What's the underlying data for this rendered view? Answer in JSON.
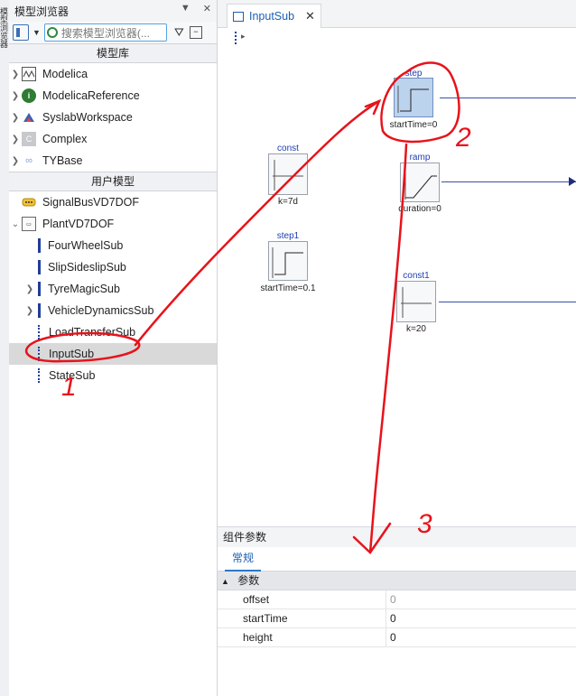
{
  "left_panel": {
    "title": "模型浏览器",
    "header_buttons": [
      "▼",
      "✕"
    ],
    "search_placeholder": "搜索模型浏览器(...",
    "section_library": "模型库",
    "section_user": "用户模型",
    "library_items": [
      {
        "label": "Modelica",
        "icon": "modelica-icon"
      },
      {
        "label": "ModelicaReference",
        "icon": "info-icon"
      },
      {
        "label": "SyslabWorkspace",
        "icon": "syslab-icon"
      },
      {
        "label": "Complex",
        "icon": "complex-icon"
      },
      {
        "label": "TYBase",
        "icon": "tybase-icon"
      }
    ],
    "user_items": [
      {
        "label": "SignalBusVD7DOF"
      },
      {
        "label": "PlantVD7DOF"
      }
    ],
    "plant_children": [
      {
        "label": "FourWheelSub"
      },
      {
        "label": "SlipSideslipSub"
      },
      {
        "label": "TyreMagicSub"
      },
      {
        "label": "VehicleDynamicsSub"
      },
      {
        "label": "LoadTransferSub"
      },
      {
        "label": "InputSub"
      },
      {
        "label": "StateSub"
      }
    ]
  },
  "vertical_strip_text": "模型浏览器",
  "editor": {
    "tab_label": "InputSub",
    "tab_close": "✕",
    "blocks": [
      {
        "name": "step",
        "param": "startTime=0"
      },
      {
        "name": "const",
        "param": "k=7d"
      },
      {
        "name": "ramp",
        "param": "duration=0"
      },
      {
        "name": "step1",
        "param": "startTime=0.1"
      },
      {
        "name": "const1",
        "param": "k=20"
      }
    ]
  },
  "params_panel": {
    "title": "组件参数",
    "tab": "常规",
    "group": "参数",
    "rows": [
      {
        "name": "offset",
        "value": "0"
      },
      {
        "name": "startTime",
        "value": "0"
      },
      {
        "name": "height",
        "value": "0"
      }
    ]
  },
  "annotations": {
    "numbers": [
      "1",
      "2",
      "3"
    ],
    "color": "#e8121a"
  },
  "colors": {
    "block_label": "#1c3db0",
    "wire": "#3b4fa8",
    "selected_row": "#d9d9d9",
    "accent": "#2a78c8"
  }
}
